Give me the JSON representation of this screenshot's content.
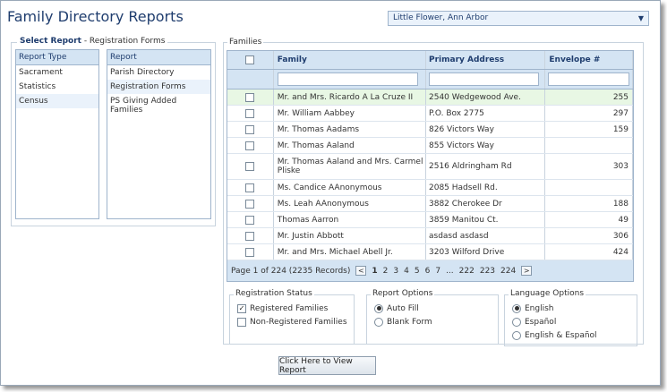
{
  "page_title": "Family Directory Reports",
  "parish_select": {
    "value": "Little Flower, Ann Arbor",
    "arrow": "▼"
  },
  "select_report": {
    "title": "Select Report",
    "subtitle": " - Registration Forms",
    "report_type_header": "Report Type",
    "report_types": [
      "Sacrament",
      "Statistics",
      "Census"
    ],
    "report_header": "Report",
    "reports": [
      "Parish Directory",
      "Registration Forms",
      "PS Giving Added Families"
    ]
  },
  "families": {
    "legend": "Families",
    "columns": {
      "family": "Family",
      "address": "Primary Address",
      "envelope": "Envelope #"
    },
    "rows": [
      {
        "family": "Mr. and Mrs. Ricardo A La Cruze II",
        "address": "2540 Wedgewood Ave.",
        "envelope": "255"
      },
      {
        "family": "Mr. William Aabbey",
        "address": "P.O. Box 2775",
        "envelope": "297"
      },
      {
        "family": "Mr. Thomas Aadams",
        "address": "826 Victors Way",
        "envelope": "159"
      },
      {
        "family": "Mr. Thomas Aaland",
        "address": "855 Victors Way",
        "envelope": ""
      },
      {
        "family": "Mr. Thomas Aaland and Mrs. Carmel Pliske",
        "address": "2516 Aldringham Rd",
        "envelope": "303"
      },
      {
        "family": "Ms. Candice AAnonymous",
        "address": "2085 Hadsell Rd.",
        "envelope": ""
      },
      {
        "family": "Ms. Leah AAnonymous",
        "address": "3882 Cherokee Dr",
        "envelope": "188"
      },
      {
        "family": "Thomas Aarron",
        "address": "3859 Manitou Ct.",
        "envelope": "49"
      },
      {
        "family": "Mr. Justin Abbott",
        "address": "asdasd asdasd",
        "envelope": "306"
      },
      {
        "family": "Mr. and Mrs. Michael Abell Jr.",
        "address": "3203 Wilford Drive",
        "envelope": "424"
      }
    ],
    "pager": {
      "summary": "Page 1 of 224 (2235 Records)",
      "prev": "<",
      "pages": [
        "1",
        "2",
        "3",
        "4",
        "5",
        "6",
        "7",
        "...",
        "222",
        "223",
        "224"
      ],
      "next": ">"
    }
  },
  "registration_status": {
    "legend": "Registration Status",
    "options": [
      {
        "label": "Registered Families",
        "checked": true
      },
      {
        "label": "Non-Registered Families",
        "checked": false
      }
    ]
  },
  "report_options": {
    "legend": "Report Options",
    "options": [
      {
        "label": "Auto Fill",
        "selected": true
      },
      {
        "label": "Blank Form",
        "selected": false
      }
    ]
  },
  "language_options": {
    "legend": "Language Options",
    "options": [
      {
        "label": "English",
        "selected": true
      },
      {
        "label": "Español",
        "selected": false
      },
      {
        "label": "English & Español",
        "selected": false
      }
    ]
  },
  "view_report_button": "Click Here to View Report"
}
